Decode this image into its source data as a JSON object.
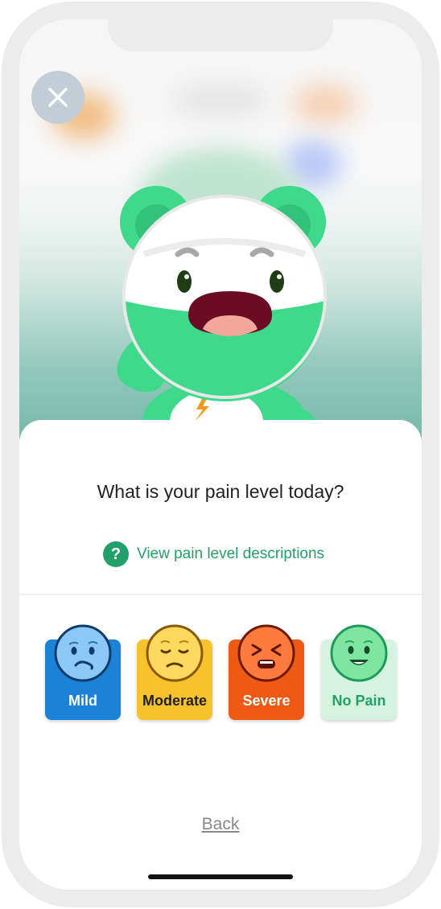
{
  "question": "What is your pain level today?",
  "help_link": {
    "icon": "question-circle-icon",
    "label": "View pain level descriptions"
  },
  "pain_levels": [
    {
      "label": "Mild",
      "face": "confused-face-icon",
      "card_color": "#1b82d8",
      "face_color": "#8cc8f5",
      "text_color": "#ffffff"
    },
    {
      "label": "Moderate",
      "face": "sad-face-icon",
      "card_color": "#f8c22c",
      "face_color": "#ffd860",
      "text_color": "#222222"
    },
    {
      "label": "Severe",
      "face": "distressed-face-icon",
      "card_color": "#ee5a14",
      "face_color": "#ff7a3d",
      "text_color": "#ffffff"
    },
    {
      "label": "No Pain",
      "face": "happy-face-icon",
      "card_color": "#d6f3e1",
      "face_color": "#7fe6a2",
      "text_color": "#22a06b"
    }
  ],
  "back_label": "Back",
  "colors": {
    "accent": "#22a06b",
    "mascot": "#3ed98a"
  }
}
